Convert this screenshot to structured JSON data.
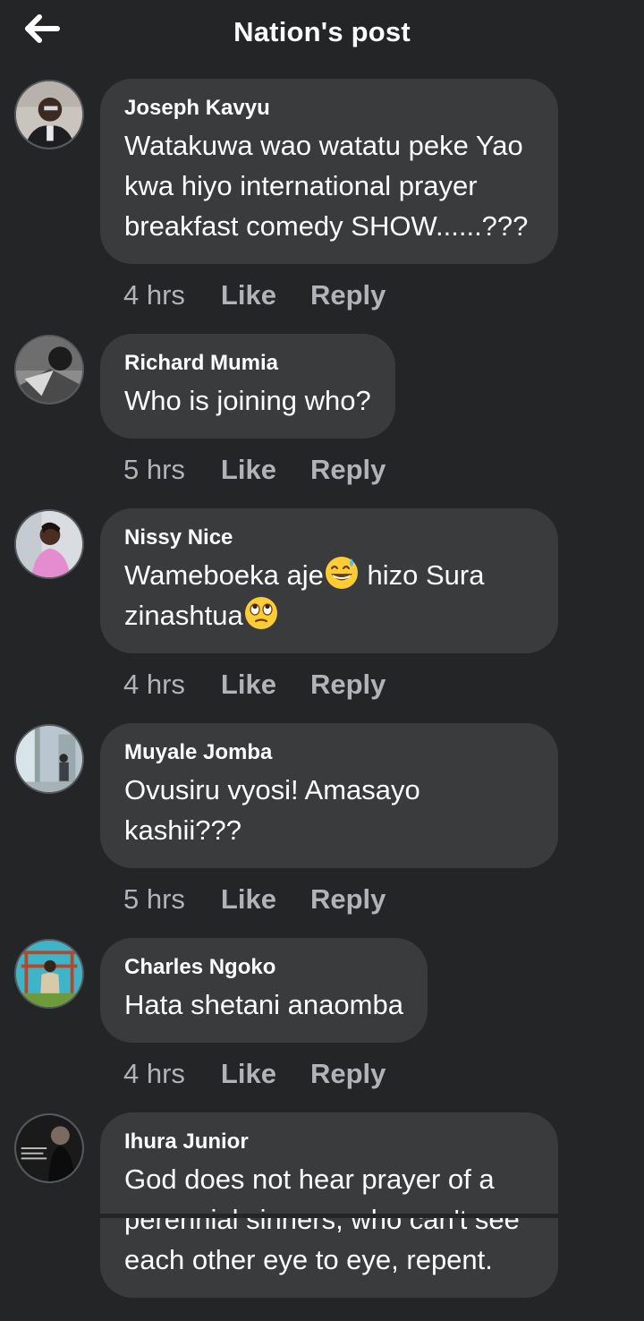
{
  "header": {
    "title": "Nation's post",
    "back_icon": "arrow-left-icon"
  },
  "colors": {
    "background": "#242527",
    "bubble": "#3a3b3d",
    "text": "#ffffff",
    "secondary_text": "#b0b3b8"
  },
  "action_labels": {
    "like": "Like",
    "reply": "Reply"
  },
  "comments": [
    {
      "author": "Joseph Kavyu",
      "text": "Watakuwa wao watatu peke Yao kwa hiyo international prayer breakfast comedy SHOW......???",
      "time": "4 hrs"
    },
    {
      "author": "Richard Mumia",
      "text": "Who is joining who?",
      "time": "5 hrs"
    },
    {
      "author": "Nissy Nice",
      "text_part1": "Wameboeka aje",
      "emoji1": "grinning-sweat-emoji",
      "text_part2": " hizo Sura zinashtua",
      "emoji2": "eye-roll-emoji",
      "time": "4 hrs"
    },
    {
      "author": "Muyale Jomba",
      "text": "Ovusiru vyosi! Amasayo kashii???",
      "time": "5 hrs"
    },
    {
      "author": "Charles Ngoko",
      "text": "Hata shetani anaomba",
      "time": "4 hrs"
    },
    {
      "author": "Ihura Junior",
      "text": "God does not hear prayer of a perennial sinners, who can't see each other eye to eye, repent."
    }
  ]
}
